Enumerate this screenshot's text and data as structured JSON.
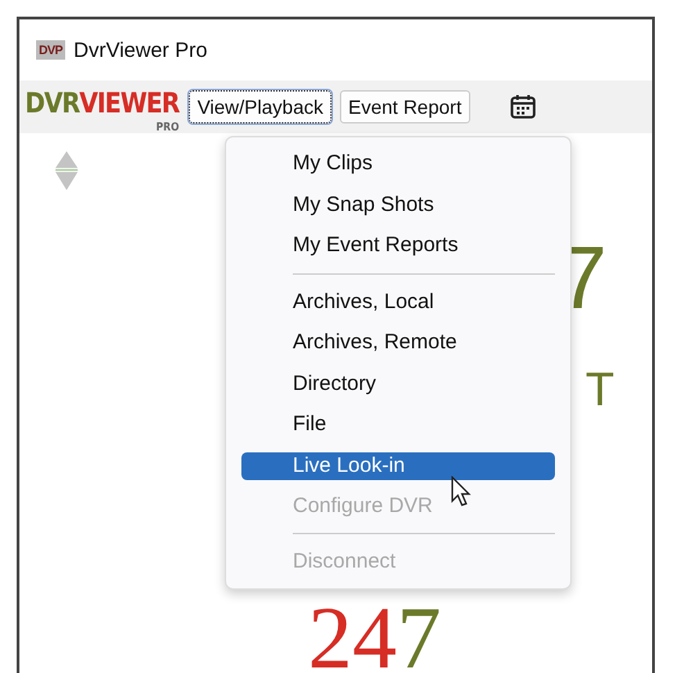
{
  "window": {
    "title": "DvrViewer Pro",
    "app_icon": "DVP"
  },
  "toolbar": {
    "logo": {
      "part_1": "DVR",
      "part_2": "VIEWER",
      "part_3": "PRO"
    },
    "buttons": [
      {
        "label": "View/Playback",
        "focused": true
      },
      {
        "label": "Event Report",
        "focused": false
      }
    ]
  },
  "background_text": [
    {
      "text": "7",
      "color": "#6b7a2a"
    },
    {
      "text": "T",
      "color": "#6b7a2a"
    }
  ],
  "background_number": {
    "part_1": "24",
    "part_2": "7"
  },
  "menu": [
    {
      "kind": "item",
      "label": "My Clips",
      "disabled": false,
      "selected": false
    },
    {
      "kind": "item",
      "label": "My Snap Shots",
      "disabled": false,
      "selected": false
    },
    {
      "kind": "item",
      "label": "My Event Reports",
      "disabled": false,
      "selected": false
    },
    {
      "kind": "separator"
    },
    {
      "kind": "item",
      "label": "Archives, Local",
      "disabled": false,
      "selected": false
    },
    {
      "kind": "item",
      "label": "Archives, Remote",
      "disabled": false,
      "selected": false
    },
    {
      "kind": "item",
      "label": "Directory",
      "disabled": false,
      "selected": false
    },
    {
      "kind": "item",
      "label": "File",
      "disabled": false,
      "selected": false
    },
    {
      "kind": "item",
      "label": "Live Look-in",
      "disabled": false,
      "selected": true
    },
    {
      "kind": "item",
      "label": "Configure DVR",
      "disabled": true,
      "selected": false
    },
    {
      "kind": "separator"
    },
    {
      "kind": "item",
      "label": "Disconnect",
      "disabled": true,
      "selected": false
    }
  ]
}
